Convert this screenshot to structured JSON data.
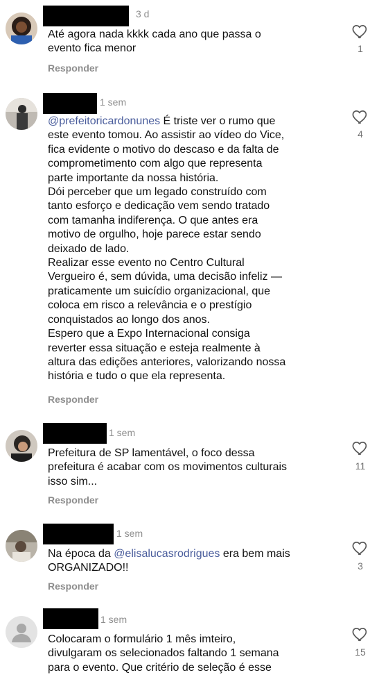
{
  "colors": {
    "text": "#111111",
    "meta": "#8e8e8e",
    "mention": "#4a5d9c",
    "heart_outline": "#5a5a5a"
  },
  "comments": [
    {
      "time": "3 d",
      "text_lines": [
        "Até agora nada kkkk cada ano que passa o",
        "evento fica menor"
      ],
      "reply_label": "Responder",
      "likes": "1",
      "icon": "heart-outline-icon"
    },
    {
      "time": "1 sem",
      "mention": "@prefeitoricardonunes",
      "text_after_mention": " É triste ver o rumo que",
      "text_lines": [
        "este evento tomou. Ao assistir ao vídeo do Vice,",
        "fica evidente o motivo do descaso e da falta de",
        "comprometimento com algo que representa",
        "parte importante da nossa história.",
        "Dói perceber que um legado construído com",
        "tanto esforço e dedicação vem sendo tratado",
        "com tamanha indiferença. O que antes era",
        "motivo de orgulho, hoje parece estar sendo",
        "deixado de lado.",
        "Realizar esse evento no Centro Cultural",
        "Vergueiro é, sem dúvida, uma decisão infeliz —",
        "praticamente um suicídio organizacional, que",
        "coloca em risco a relevância e o prestígio",
        "conquistados ao longo dos anos.",
        "Espero que a Expo Internacional consiga",
        "reverter essa situação e esteja realmente à",
        "altura das edições anteriores, valorizando nossa",
        "história e tudo o que ela representa."
      ],
      "reply_label": "Responder",
      "likes": "4",
      "icon": "heart-outline-icon"
    },
    {
      "time": "1 sem",
      "text_lines": [
        "Prefeitura de SP lamentável, o foco dessa",
        "prefeitura é acabar com os movimentos culturais",
        "isso sim..."
      ],
      "reply_label": "Responder",
      "likes": "11",
      "icon": "heart-outline-icon"
    },
    {
      "time": "1 sem",
      "text_before_mention": "Na época da ",
      "mention": "@elisalucasrodrigues",
      "text_after_mention": " era bem mais",
      "text_lines": [
        "ORGANIZADO!!"
      ],
      "reply_label": "Responder",
      "likes": "3",
      "icon": "heart-outline-icon"
    },
    {
      "time": "1 sem",
      "text_lines": [
        "Colocaram o formulário 1 mês imteiro,",
        "divulgaram os selecionados faltando 1 semana",
        "para o evento. Que critério de seleção é esse"
      ],
      "likes": "15",
      "icon": "heart-outline-icon"
    }
  ]
}
